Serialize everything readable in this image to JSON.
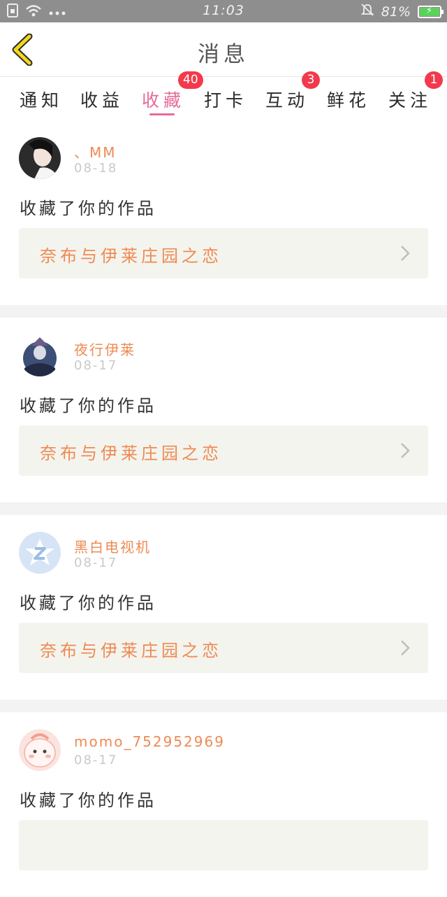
{
  "status_bar": {
    "time": "11:03",
    "battery_text": "81%"
  },
  "header": {
    "title": "消息"
  },
  "tabs": [
    {
      "label": "通知",
      "badge": ""
    },
    {
      "label": "收益",
      "badge": ""
    },
    {
      "label": "收藏",
      "badge": "40",
      "active": true
    },
    {
      "label": "打卡",
      "badge": ""
    },
    {
      "label": "互动",
      "badge": "3"
    },
    {
      "label": "鲜花",
      "badge": ""
    },
    {
      "label": "关注",
      "badge": "1"
    }
  ],
  "messages": [
    {
      "user": "、MM",
      "date": "08-18",
      "action": "收藏了你的作品",
      "work": "奈布与伊莱庄园之恋"
    },
    {
      "user": "夜行伊莱",
      "date": "08-17",
      "action": "收藏了你的作品",
      "work": "奈布与伊莱庄园之恋"
    },
    {
      "user": "黑白电视机",
      "date": "08-17",
      "action": "收藏了你的作品",
      "work": "奈布与伊莱庄园之恋"
    },
    {
      "user": "momo_752952969",
      "date": "08-17",
      "action": "收藏了你的作品",
      "work": ""
    }
  ],
  "colors": {
    "accent_pink": "#e56b9b",
    "orange_text": "#ee8a53",
    "badge_red": "#f23a4c",
    "back_yellow": "#f5d71c"
  },
  "icons": [
    "sim-icon",
    "wifi-icon",
    "more-dots-icon",
    "silent-bell-icon",
    "battery-icon",
    "back-chevron-icon",
    "chevron-right-icon"
  ]
}
